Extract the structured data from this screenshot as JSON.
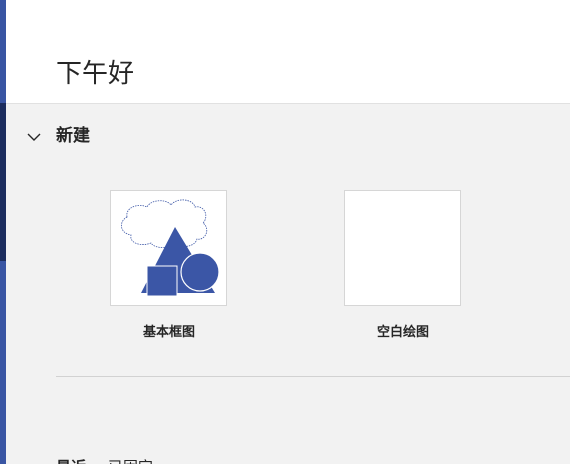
{
  "header": {
    "greeting": "下午好"
  },
  "new_section": {
    "label": "新建",
    "chevron_icon": "chevron-down-icon",
    "templates": [
      {
        "label": "基本框图",
        "thumbnail_icon": "basic-shapes-thumbnail"
      },
      {
        "label": "空白绘图",
        "thumbnail_icon": "blank-page-thumbnail"
      }
    ]
  },
  "recent_section": {
    "label": "最近",
    "tab_pinned": "已固定"
  },
  "colors": {
    "accent": "#3955a3",
    "rail_dark": "#1c2d5e",
    "background": "#f2f2f2",
    "shape_fill": "#3b56a6"
  }
}
